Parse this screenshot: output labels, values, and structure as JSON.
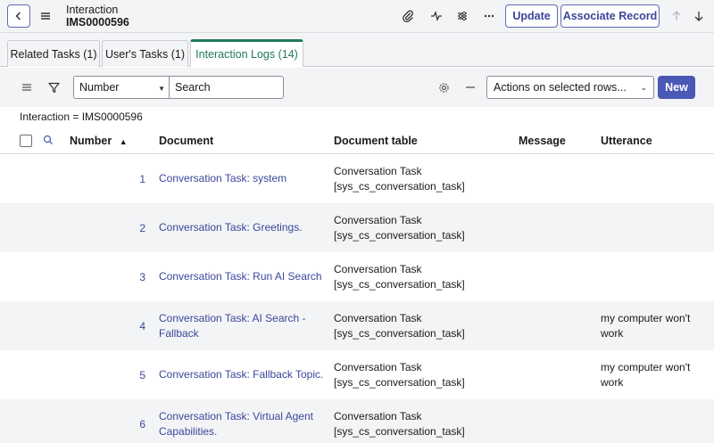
{
  "header": {
    "record_type": "Interaction",
    "record_number": "IMS0000596",
    "update_label": "Update",
    "associate_label": "Associate Record",
    "icons": [
      "chevron-left-icon",
      "menu-icon",
      "paperclip-icon",
      "activity-icon",
      "sliders-icon",
      "more-icon",
      "arrow-up-icon",
      "arrow-down-icon"
    ]
  },
  "tabs": [
    {
      "label": "Related Tasks (1)",
      "active": false
    },
    {
      "label": "User's Tasks (1)",
      "active": false
    },
    {
      "label": "Interaction Logs (14)",
      "active": true
    }
  ],
  "toolbar": {
    "field_value": "Number",
    "search_placeholder": "Search",
    "actions_label": "Actions on selected rows...",
    "new_label": "New"
  },
  "breadcrumb": "Interaction = IMS0000596",
  "table": {
    "columns": [
      "Number",
      "Document",
      "Document table",
      "Message",
      "Utterance"
    ],
    "sort_indicator": "▲",
    "rows": [
      {
        "number": "1",
        "document": "Conversation Task: system",
        "document_table": "Conversation Task [sys_cs_conversation_task]",
        "message": "",
        "utterance": ""
      },
      {
        "number": "2",
        "document": "Conversation Task: Greetings.",
        "document_table": "Conversation Task [sys_cs_conversation_task]",
        "message": "",
        "utterance": ""
      },
      {
        "number": "3",
        "document": "Conversation Task: Run AI Search",
        "document_table": "Conversation Task [sys_cs_conversation_task]",
        "message": "",
        "utterance": ""
      },
      {
        "number": "4",
        "document": "Conversation Task: AI Search - Fallback",
        "document_table": "Conversation Task [sys_cs_conversation_task]",
        "message": "",
        "utterance": "my computer won't work"
      },
      {
        "number": "5",
        "document": "Conversation Task: Fallback Topic.",
        "document_table": "Conversation Task [sys_cs_conversation_task]",
        "message": "",
        "utterance": "my computer won't work"
      },
      {
        "number": "6",
        "document": "Conversation Task: Virtual Agent Capabilities.",
        "document_table": "Conversation Task [sys_cs_conversation_task]",
        "message": "",
        "utterance": ""
      }
    ]
  },
  "colors": {
    "accent": "#3b4799",
    "primary_button": "#4a58b5",
    "active_tab": "#1f7a5a",
    "chrome_bg": "#f3f4f6"
  }
}
